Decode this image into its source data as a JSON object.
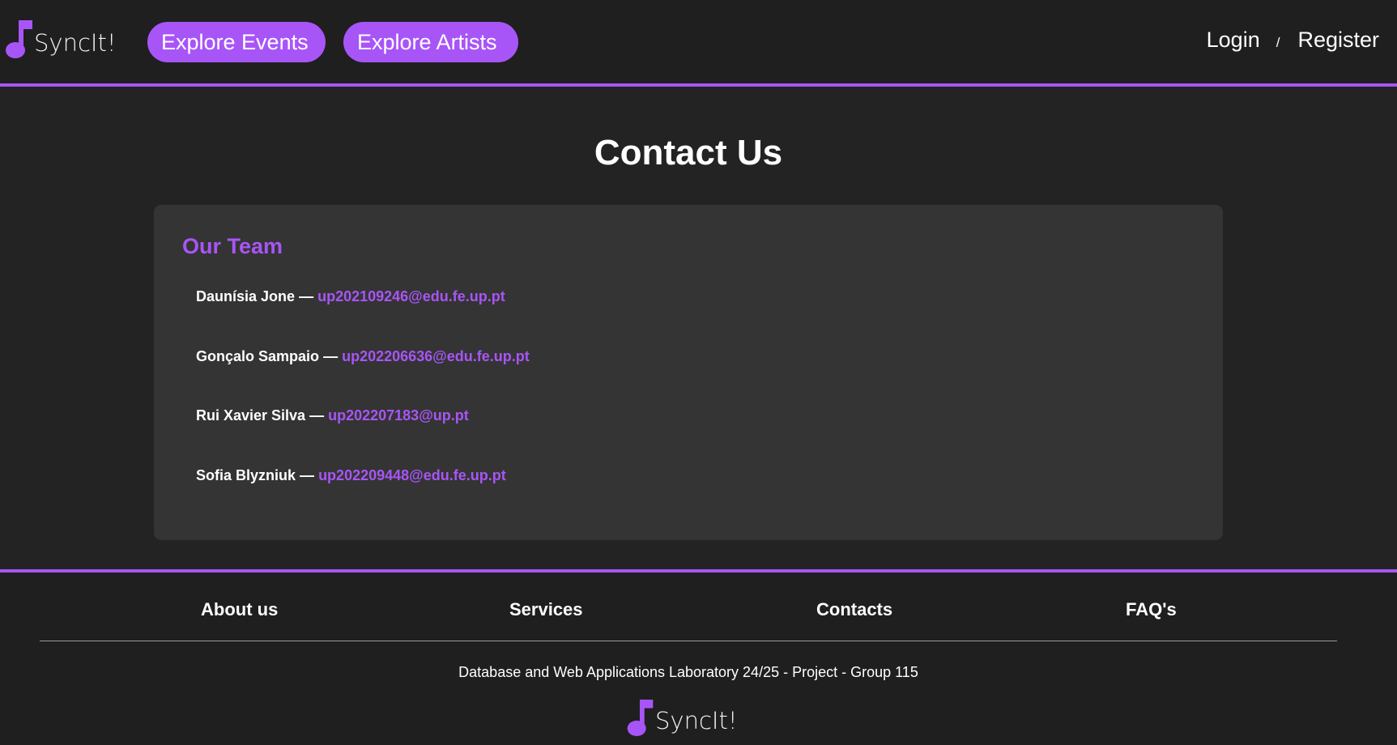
{
  "brand": {
    "name": "SyncIt!",
    "accent": "#a855f7",
    "logo_icon": "music-note-icon"
  },
  "header": {
    "nav": [
      {
        "label": "Explore Events"
      },
      {
        "label": "Explore Artists"
      }
    ],
    "auth": {
      "login": "Login",
      "separator": "/",
      "register": "Register"
    }
  },
  "main": {
    "title": "Contact Us",
    "team": {
      "heading": "Our Team",
      "dash": "—",
      "members": [
        {
          "name": "Daunísia Jone",
          "email": "up202109246@edu.fe.up.pt"
        },
        {
          "name": "Gonçalo Sampaio",
          "email": "up202206636@edu.fe.up.pt"
        },
        {
          "name": "Rui Xavier Silva",
          "email": "up202207183@up.pt"
        },
        {
          "name": "Sofia Blyzniuk",
          "email": "up202209448@edu.fe.up.pt"
        }
      ]
    }
  },
  "footer": {
    "links": [
      {
        "label": "About us"
      },
      {
        "label": "Services"
      },
      {
        "label": "Contacts"
      },
      {
        "label": "FAQ's"
      }
    ],
    "text": "Database and Web Applications Laboratory 24/25 - Project - Group 115"
  }
}
